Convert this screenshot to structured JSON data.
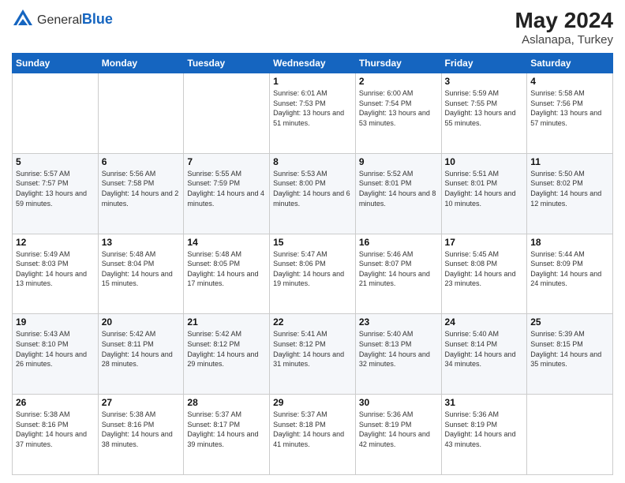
{
  "header": {
    "logo_general": "General",
    "logo_blue": "Blue",
    "month_year": "May 2024",
    "location": "Aslanapa, Turkey"
  },
  "weekdays": [
    "Sunday",
    "Monday",
    "Tuesday",
    "Wednesday",
    "Thursday",
    "Friday",
    "Saturday"
  ],
  "weeks": [
    [
      {
        "day": "",
        "sunrise": "",
        "sunset": "",
        "daylight": ""
      },
      {
        "day": "",
        "sunrise": "",
        "sunset": "",
        "daylight": ""
      },
      {
        "day": "",
        "sunrise": "",
        "sunset": "",
        "daylight": ""
      },
      {
        "day": "1",
        "sunrise": "Sunrise: 6:01 AM",
        "sunset": "Sunset: 7:53 PM",
        "daylight": "Daylight: 13 hours and 51 minutes."
      },
      {
        "day": "2",
        "sunrise": "Sunrise: 6:00 AM",
        "sunset": "Sunset: 7:54 PM",
        "daylight": "Daylight: 13 hours and 53 minutes."
      },
      {
        "day": "3",
        "sunrise": "Sunrise: 5:59 AM",
        "sunset": "Sunset: 7:55 PM",
        "daylight": "Daylight: 13 hours and 55 minutes."
      },
      {
        "day": "4",
        "sunrise": "Sunrise: 5:58 AM",
        "sunset": "Sunset: 7:56 PM",
        "daylight": "Daylight: 13 hours and 57 minutes."
      }
    ],
    [
      {
        "day": "5",
        "sunrise": "Sunrise: 5:57 AM",
        "sunset": "Sunset: 7:57 PM",
        "daylight": "Daylight: 13 hours and 59 minutes."
      },
      {
        "day": "6",
        "sunrise": "Sunrise: 5:56 AM",
        "sunset": "Sunset: 7:58 PM",
        "daylight": "Daylight: 14 hours and 2 minutes."
      },
      {
        "day": "7",
        "sunrise": "Sunrise: 5:55 AM",
        "sunset": "Sunset: 7:59 PM",
        "daylight": "Daylight: 14 hours and 4 minutes."
      },
      {
        "day": "8",
        "sunrise": "Sunrise: 5:53 AM",
        "sunset": "Sunset: 8:00 PM",
        "daylight": "Daylight: 14 hours and 6 minutes."
      },
      {
        "day": "9",
        "sunrise": "Sunrise: 5:52 AM",
        "sunset": "Sunset: 8:01 PM",
        "daylight": "Daylight: 14 hours and 8 minutes."
      },
      {
        "day": "10",
        "sunrise": "Sunrise: 5:51 AM",
        "sunset": "Sunset: 8:01 PM",
        "daylight": "Daylight: 14 hours and 10 minutes."
      },
      {
        "day": "11",
        "sunrise": "Sunrise: 5:50 AM",
        "sunset": "Sunset: 8:02 PM",
        "daylight": "Daylight: 14 hours and 12 minutes."
      }
    ],
    [
      {
        "day": "12",
        "sunrise": "Sunrise: 5:49 AM",
        "sunset": "Sunset: 8:03 PM",
        "daylight": "Daylight: 14 hours and 13 minutes."
      },
      {
        "day": "13",
        "sunrise": "Sunrise: 5:48 AM",
        "sunset": "Sunset: 8:04 PM",
        "daylight": "Daylight: 14 hours and 15 minutes."
      },
      {
        "day": "14",
        "sunrise": "Sunrise: 5:48 AM",
        "sunset": "Sunset: 8:05 PM",
        "daylight": "Daylight: 14 hours and 17 minutes."
      },
      {
        "day": "15",
        "sunrise": "Sunrise: 5:47 AM",
        "sunset": "Sunset: 8:06 PM",
        "daylight": "Daylight: 14 hours and 19 minutes."
      },
      {
        "day": "16",
        "sunrise": "Sunrise: 5:46 AM",
        "sunset": "Sunset: 8:07 PM",
        "daylight": "Daylight: 14 hours and 21 minutes."
      },
      {
        "day": "17",
        "sunrise": "Sunrise: 5:45 AM",
        "sunset": "Sunset: 8:08 PM",
        "daylight": "Daylight: 14 hours and 23 minutes."
      },
      {
        "day": "18",
        "sunrise": "Sunrise: 5:44 AM",
        "sunset": "Sunset: 8:09 PM",
        "daylight": "Daylight: 14 hours and 24 minutes."
      }
    ],
    [
      {
        "day": "19",
        "sunrise": "Sunrise: 5:43 AM",
        "sunset": "Sunset: 8:10 PM",
        "daylight": "Daylight: 14 hours and 26 minutes."
      },
      {
        "day": "20",
        "sunrise": "Sunrise: 5:42 AM",
        "sunset": "Sunset: 8:11 PM",
        "daylight": "Daylight: 14 hours and 28 minutes."
      },
      {
        "day": "21",
        "sunrise": "Sunrise: 5:42 AM",
        "sunset": "Sunset: 8:12 PM",
        "daylight": "Daylight: 14 hours and 29 minutes."
      },
      {
        "day": "22",
        "sunrise": "Sunrise: 5:41 AM",
        "sunset": "Sunset: 8:12 PM",
        "daylight": "Daylight: 14 hours and 31 minutes."
      },
      {
        "day": "23",
        "sunrise": "Sunrise: 5:40 AM",
        "sunset": "Sunset: 8:13 PM",
        "daylight": "Daylight: 14 hours and 32 minutes."
      },
      {
        "day": "24",
        "sunrise": "Sunrise: 5:40 AM",
        "sunset": "Sunset: 8:14 PM",
        "daylight": "Daylight: 14 hours and 34 minutes."
      },
      {
        "day": "25",
        "sunrise": "Sunrise: 5:39 AM",
        "sunset": "Sunset: 8:15 PM",
        "daylight": "Daylight: 14 hours and 35 minutes."
      }
    ],
    [
      {
        "day": "26",
        "sunrise": "Sunrise: 5:38 AM",
        "sunset": "Sunset: 8:16 PM",
        "daylight": "Daylight: 14 hours and 37 minutes."
      },
      {
        "day": "27",
        "sunrise": "Sunrise: 5:38 AM",
        "sunset": "Sunset: 8:16 PM",
        "daylight": "Daylight: 14 hours and 38 minutes."
      },
      {
        "day": "28",
        "sunrise": "Sunrise: 5:37 AM",
        "sunset": "Sunset: 8:17 PM",
        "daylight": "Daylight: 14 hours and 39 minutes."
      },
      {
        "day": "29",
        "sunrise": "Sunrise: 5:37 AM",
        "sunset": "Sunset: 8:18 PM",
        "daylight": "Daylight: 14 hours and 41 minutes."
      },
      {
        "day": "30",
        "sunrise": "Sunrise: 5:36 AM",
        "sunset": "Sunset: 8:19 PM",
        "daylight": "Daylight: 14 hours and 42 minutes."
      },
      {
        "day": "31",
        "sunrise": "Sunrise: 5:36 AM",
        "sunset": "Sunset: 8:19 PM",
        "daylight": "Daylight: 14 hours and 43 minutes."
      },
      {
        "day": "",
        "sunrise": "",
        "sunset": "",
        "daylight": ""
      }
    ]
  ]
}
